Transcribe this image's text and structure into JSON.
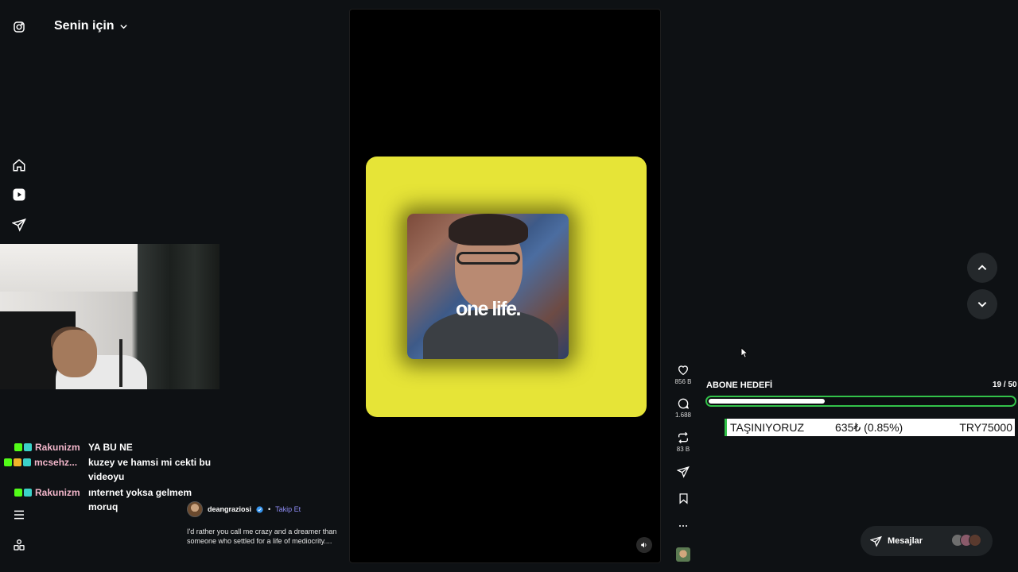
{
  "header": {
    "title": "Senin için"
  },
  "sidebar": {
    "icons": [
      "instagram-icon",
      "home-icon",
      "reels-icon",
      "direct-icon",
      "menu-icon",
      "more-icon"
    ]
  },
  "chat": [
    {
      "user": "Rakunizm",
      "message": "YA BU NE",
      "user_color": "#f2b6ca"
    },
    {
      "user": "mcsehz...",
      "message": "kuzey ve hamsi mi cekti bu videoyu",
      "user_color": "#f2b6ca"
    },
    {
      "user": "Rakunizm",
      "message": "ınternet yoksa gelmem moruq",
      "user_color": "#f2b6ca"
    }
  ],
  "video": {
    "overlay_text": "one life.",
    "author": "deangraziosi",
    "follow_label": "Takip Et",
    "separator": "•",
    "caption": "I'd rather you call me crazy and a dreamer than someone who settled for a life of mediocrity....",
    "accent": "#e6e437"
  },
  "actions": {
    "likes": "856 B",
    "comments": "1.688",
    "reposts": "83 B"
  },
  "goal": {
    "title": "ABONE HEDEFİ",
    "count": "19 / 50",
    "progress": 0.38,
    "color": "#33c24a"
  },
  "donation": {
    "label": "TAŞINIYORUZ",
    "amount": "635₺ (0.85%)",
    "target": "TRY75000"
  },
  "messages": {
    "label": "Mesajlar"
  }
}
